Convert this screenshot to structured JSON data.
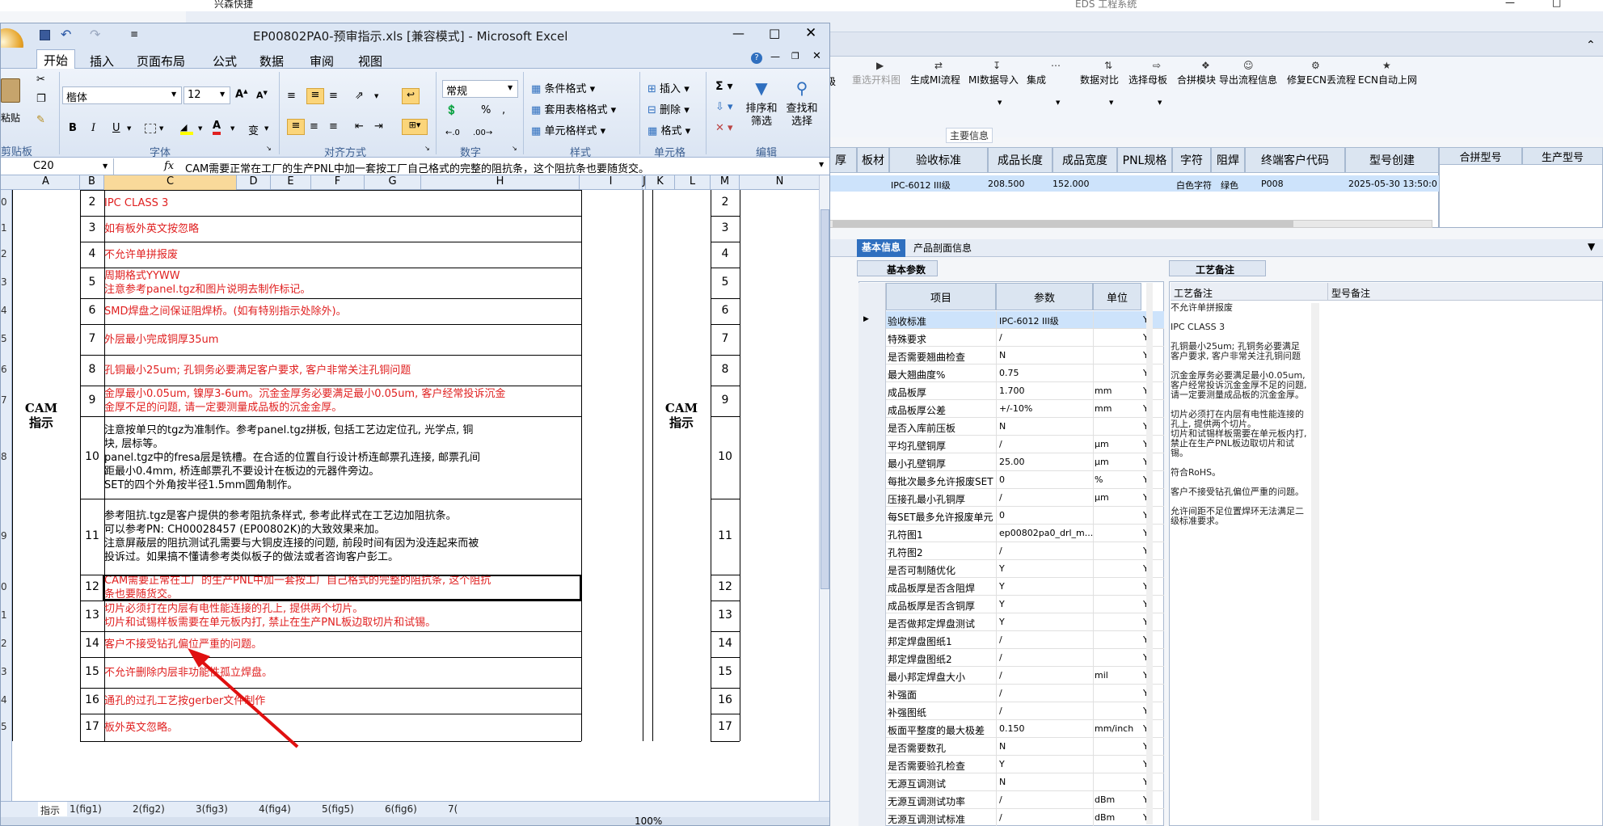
{
  "eds": {
    "title": "EDS 工程系统",
    "quick_toolbar_label": "兴森快捷",
    "toolbar": [
      {
        "label": "重选开料图"
      },
      {
        "label": "生成MI流程"
      },
      {
        "label": "MI数据导入"
      },
      {
        "label": "集成"
      },
      {
        "label": "数据对比"
      },
      {
        "label": "选择母板"
      },
      {
        "label": "合拼模块"
      },
      {
        "label": "导出流程信息"
      },
      {
        "label": "修复ECN丢流程"
      },
      {
        "label": "ECN自动上网"
      }
    ],
    "main_info_label": "主要信息",
    "grid_headers": [
      "厚",
      "板材",
      "验收标准",
      "成品长度",
      "成品宽度",
      "PNL规格",
      "字符",
      "阻焊",
      "终端客户代码",
      "型号创建"
    ],
    "grid_row": {
      "standard": "IPC-6012 III级",
      "length": "208.500",
      "width": "152.000",
      "char": "白色字符",
      "mask": "绿色",
      "customer": "P008",
      "created": "2025-05-30 13:50:0"
    },
    "right_headers": [
      "合拼型号",
      "生产型号"
    ],
    "tabs": [
      "基本信息",
      "产品剖面信息"
    ],
    "basic_params_tab": "基本参数",
    "process_notes_tab": "工艺备注",
    "params_headers": [
      "项目",
      "参数",
      "单位"
    ],
    "params": [
      {
        "item": "验收标准",
        "value": "IPC-6012 III级",
        "unit": "",
        "flag": "Y"
      },
      {
        "item": "特殊要求",
        "value": "/",
        "unit": "",
        "flag": "Y"
      },
      {
        "item": "是否需要翘曲检查",
        "value": "N",
        "unit": "",
        "flag": "Y"
      },
      {
        "item": "最大翘曲度%",
        "value": "0.75",
        "unit": "",
        "flag": "Y"
      },
      {
        "item": "成品板厚",
        "value": "1.700",
        "unit": "mm",
        "flag": "Y"
      },
      {
        "item": "成品板厚公差",
        "value": "+/-10%",
        "unit": "mm",
        "flag": "Y"
      },
      {
        "item": "是否入库前压板",
        "value": "N",
        "unit": "",
        "flag": "Y"
      },
      {
        "item": "平均孔壁铜厚",
        "value": "/",
        "unit": "μm",
        "flag": "Y"
      },
      {
        "item": "最小孔壁铜厚",
        "value": "25.00",
        "unit": "μm",
        "flag": "Y"
      },
      {
        "item": "每批次最多允许报废SET",
        "value": "0",
        "unit": "%",
        "flag": "Y"
      },
      {
        "item": "压接孔最小孔铜厚",
        "value": "/",
        "unit": "μm",
        "flag": "Y"
      },
      {
        "item": "每SET最多允许报废单元",
        "value": "0",
        "unit": "",
        "flag": "Y"
      },
      {
        "item": "孔符图1",
        "value": "ep00802pa0_drl_m...",
        "unit": "",
        "flag": "Y"
      },
      {
        "item": "孔符图2",
        "value": "/",
        "unit": "",
        "flag": "Y"
      },
      {
        "item": "是否可制随优化",
        "value": "Y",
        "unit": "",
        "flag": "Y"
      },
      {
        "item": "成品板厚是否含阻焊",
        "value": "Y",
        "unit": "",
        "flag": "Y"
      },
      {
        "item": "成品板厚是否含铜厚",
        "value": "Y",
        "unit": "",
        "flag": "Y"
      },
      {
        "item": "是否做邦定焊盘测试",
        "value": "Y",
        "unit": "",
        "flag": "Y"
      },
      {
        "item": "邦定焊盘图纸1",
        "value": "/",
        "unit": "",
        "flag": "Y"
      },
      {
        "item": "邦定焊盘图纸2",
        "value": "/",
        "unit": "",
        "flag": "Y"
      },
      {
        "item": "最小邦定焊盘大小",
        "value": "/",
        "unit": "mil",
        "flag": "Y"
      },
      {
        "item": "补强面",
        "value": "/",
        "unit": "",
        "flag": "Y"
      },
      {
        "item": "补强图纸",
        "value": "/",
        "unit": "",
        "flag": "Y"
      },
      {
        "item": "板面平整度的最大极差",
        "value": "0.150",
        "unit": "mm/inch",
        "flag": "Y"
      },
      {
        "item": "是否需要数孔",
        "value": "N",
        "unit": "",
        "flag": "Y"
      },
      {
        "item": "是否需要验孔检查",
        "value": "Y",
        "unit": "",
        "flag": "Y"
      },
      {
        "item": "无源互调测试",
        "value": "N",
        "unit": "",
        "flag": "Y"
      },
      {
        "item": "无源互调测试功率",
        "value": "/",
        "unit": "dBm",
        "flag": "Y"
      },
      {
        "item": "无源互调测试标准",
        "value": "/",
        "unit": "dBm",
        "flag": "Y"
      }
    ],
    "notes_headers": [
      "工艺备注",
      "型号备注"
    ],
    "notes_text": "不允许单拼报废\n\nIPC CLASS 3\n\n孔铜最小25um; 孔铜务必要满足客户要求, 客户非常关注孔铜问题\n\n沉金金厚务必要满足最小0.05um, 客户经常投诉沉金金厚不足的问题, 请一定要测量成品板的沉金金厚。\n\n切片必须打在内层有电性能连接的孔上, 提供两个切片。\n切片和试锡样板需要在单元板内打, 禁止在生产PNL板边取切片和试锡。\n\n符合RoHS。\n\n客户不接受钻孔偏位严重的问题。\n\n允许间距不足位置焊环无法满足二级标准要求。"
  },
  "excel": {
    "title": "EP00802PA0-预审指示.xls  [兼容模式] - Microsoft Excel",
    "ribbon_tabs": [
      "开始",
      "插入",
      "页面布局",
      "公式",
      "数据",
      "审阅",
      "视图"
    ],
    "font_name": "楷体",
    "font_size": "12",
    "number_format": "常规",
    "paste_label": "粘贴",
    "clipboard_label": "剪贴板",
    "groups": [
      "字体",
      "对齐方式",
      "数字",
      "样式",
      "单元格",
      "编辑"
    ],
    "style_buttons": [
      "条件格式",
      "套用表格格式",
      "单元格样式"
    ],
    "cell_buttons": [
      "插入",
      "删除",
      "格式"
    ],
    "sort_label": "排序和\n筛选",
    "find_label": "查找和\n选择",
    "name_box": "C20",
    "formula": "CAM需要正常在工厂的生产PNL中加一套按工厂自己格式的完整的阻抗条，这个阻抗条也要随货交。",
    "col_headers": [
      "A",
      "B",
      "C",
      "D",
      "E",
      "F",
      "G",
      "H",
      "I",
      "J",
      "K",
      "L",
      "M",
      "N"
    ],
    "left_label": "CAM\n指示",
    "right_label": "CAM\n指示",
    "rows": [
      {
        "rn": "0",
        "n": "2",
        "text": "IPC CLASS 3",
        "red": true
      },
      {
        "rn": "1",
        "n": "3",
        "text": "如有板外英文按忽略",
        "red": true
      },
      {
        "rn": "2",
        "n": "4",
        "text": "不允许单拼报废",
        "red": true
      },
      {
        "rn": "3",
        "n": "5",
        "text": "周期格式YYWW\n注意参考panel.tgz和图片说明去制作标记。",
        "red": true
      },
      {
        "rn": "4",
        "n": "6",
        "text": "SMD焊盘之间保证阻焊桥。(如有特别指示处除外)。",
        "red": true
      },
      {
        "rn": "5",
        "n": "7",
        "text": "外层最小完成铜厚35um",
        "red": true
      },
      {
        "rn": "6",
        "n": "8",
        "text": "孔铜最小25um; 孔铜务必要满足客户要求, 客户非常关注孔铜问题",
        "red": true
      },
      {
        "rn": "7",
        "n": "9",
        "text": "金厚最小0.05um, 镍厚3-6um。沉金金厚务必要满足最小0.05um, 客户经常投诉沉金\n金厚不足的问题, 请一定要测量成品板的沉金金厚。",
        "red": true
      },
      {
        "rn": "8",
        "n": "10",
        "text": "注意按单只的tgz为准制作。参考panel.tgz拼板, 包括工艺边定位孔, 光学点, 铜\n块, 层标等。\npanel.tgz中的fresa层是铣槽。在合适的位置自行设计桥连邮票孔连接, 邮票孔间\n距最小0.4mm, 桥连邮票孔不要设计在板边的元器件旁边。\nSET的四个外角按半径1.5mm圆角制作。",
        "red": false
      },
      {
        "rn": "9",
        "n": "11",
        "text": "参考阻抗.tgz是客户提供的参考阻抗条样式, 参考此样式在工艺边加阻抗条。\n可以参考PN: CH00028457 (EP00802K)的大致效果来加。\n注意屏蔽层的阻抗测试孔需要与大铜皮连接的问题, 前段时间有因为没连起来而被\n投诉过。如果搞不懂请参考类似板子的做法或者咨询客户彭工。",
        "red": false
      },
      {
        "rn": "0",
        "n": "12",
        "text": "CAM需要正常在工厂的生产PNL中加一套按工厂自己格式的完整的阻抗条, 这个阻抗\n条也要随货交。",
        "red": true
      },
      {
        "rn": "1",
        "n": "13",
        "text": "切片必须打在内层有电性能连接的孔上, 提供两个切片。\n切片和试锡样板需要在单元板内打, 禁止在生产PNL板边取切片和试锡。",
        "red": true
      },
      {
        "rn": "2",
        "n": "14",
        "text": "客户不接受钻孔偏位严重的问题。",
        "red": true
      },
      {
        "rn": "3",
        "n": "15",
        "text": "不允许删除内层非功能性孤立焊盘。",
        "red": true
      },
      {
        "rn": "4",
        "n": "16",
        "text": "通孔的过孔工艺按gerber文件制作",
        "red": true
      },
      {
        "rn": "5",
        "n": "17",
        "text": "板外英文忽略。",
        "red": true
      }
    ],
    "sheet_tabs": [
      "指示",
      "1(fig1)",
      "2(fig2)",
      "3(fig3)",
      "4(fig4)",
      "5(fig5)",
      "6(fig6)",
      "7("
    ],
    "zoom": "100%"
  }
}
